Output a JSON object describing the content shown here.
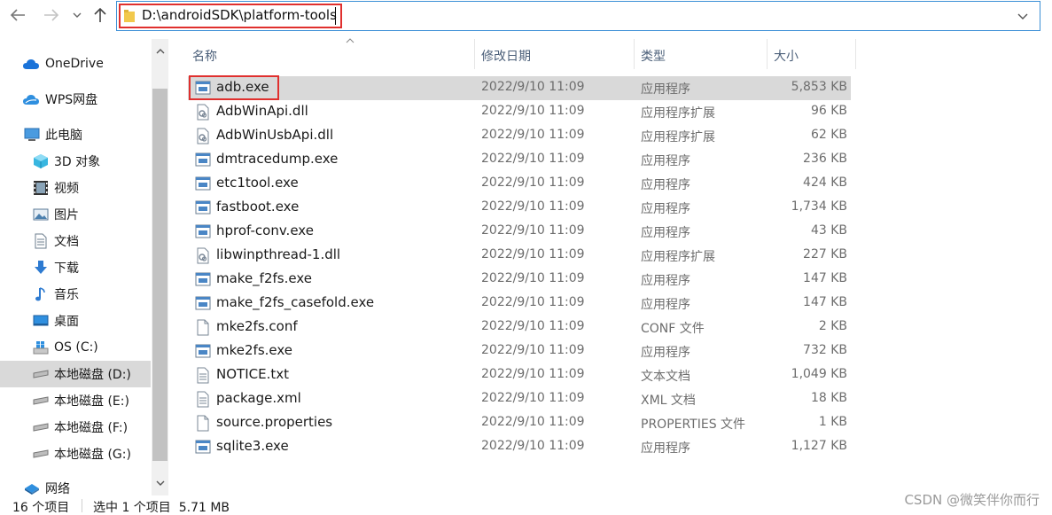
{
  "address_bar": {
    "path": "D:\\androidSDK\\platform-tools"
  },
  "sidebar": {
    "items": [
      {
        "label": "OneDrive",
        "icon": "onedrive-cloud-icon"
      },
      {
        "label": "WPS网盘",
        "icon": "wps-cloud-icon"
      },
      {
        "label": "此电脑",
        "icon": "computer-icon"
      },
      {
        "label": "3D 对象",
        "icon": "3d-objects-icon"
      },
      {
        "label": "视频",
        "icon": "video-icon"
      },
      {
        "label": "图片",
        "icon": "pictures-icon"
      },
      {
        "label": "文档",
        "icon": "documents-icon"
      },
      {
        "label": "下载",
        "icon": "download-icon"
      },
      {
        "label": "音乐",
        "icon": "music-icon"
      },
      {
        "label": "桌面",
        "icon": "desktop-icon"
      },
      {
        "label": "OS (C:)",
        "icon": "windows-drive-icon"
      },
      {
        "label": "本地磁盘 (D:)",
        "icon": "drive-icon",
        "selected": true
      },
      {
        "label": "本地磁盘 (E:)",
        "icon": "drive-icon"
      },
      {
        "label": "本地磁盘 (F:)",
        "icon": "drive-icon"
      },
      {
        "label": "本地磁盘 (G:)",
        "icon": "drive-icon"
      },
      {
        "label": "网络",
        "icon": "network-icon"
      }
    ]
  },
  "columns": {
    "name": "名称",
    "date": "修改日期",
    "type": "类型",
    "size": "大小"
  },
  "files": [
    {
      "name": "adb.exe",
      "date": "2022/9/10 11:09",
      "type": "应用程序",
      "size": "5,853 KB",
      "icon": "exe-icon",
      "selected": true
    },
    {
      "name": "AdbWinApi.dll",
      "date": "2022/9/10 11:09",
      "type": "应用程序扩展",
      "size": "96 KB",
      "icon": "dll-icon"
    },
    {
      "name": "AdbWinUsbApi.dll",
      "date": "2022/9/10 11:09",
      "type": "应用程序扩展",
      "size": "62 KB",
      "icon": "dll-icon"
    },
    {
      "name": "dmtracedump.exe",
      "date": "2022/9/10 11:09",
      "type": "应用程序",
      "size": "236 KB",
      "icon": "exe-icon"
    },
    {
      "name": "etc1tool.exe",
      "date": "2022/9/10 11:09",
      "type": "应用程序",
      "size": "424 KB",
      "icon": "exe-icon"
    },
    {
      "name": "fastboot.exe",
      "date": "2022/9/10 11:09",
      "type": "应用程序",
      "size": "1,734 KB",
      "icon": "exe-icon"
    },
    {
      "name": "hprof-conv.exe",
      "date": "2022/9/10 11:09",
      "type": "应用程序",
      "size": "43 KB",
      "icon": "exe-icon"
    },
    {
      "name": "libwinpthread-1.dll",
      "date": "2022/9/10 11:09",
      "type": "应用程序扩展",
      "size": "227 KB",
      "icon": "dll-icon"
    },
    {
      "name": "make_f2fs.exe",
      "date": "2022/9/10 11:09",
      "type": "应用程序",
      "size": "147 KB",
      "icon": "exe-icon"
    },
    {
      "name": "make_f2fs_casefold.exe",
      "date": "2022/9/10 11:09",
      "type": "应用程序",
      "size": "147 KB",
      "icon": "exe-icon"
    },
    {
      "name": "mke2fs.conf",
      "date": "2022/9/10 11:09",
      "type": "CONF 文件",
      "size": "2 KB",
      "icon": "file-icon"
    },
    {
      "name": "mke2fs.exe",
      "date": "2022/9/10 11:09",
      "type": "应用程序",
      "size": "732 KB",
      "icon": "exe-icon"
    },
    {
      "name": "NOTICE.txt",
      "date": "2022/9/10 11:09",
      "type": "文本文档",
      "size": "1,049 KB",
      "icon": "text-file-icon"
    },
    {
      "name": "package.xml",
      "date": "2022/9/10 11:09",
      "type": "XML 文档",
      "size": "18 KB",
      "icon": "text-file-icon"
    },
    {
      "name": "source.properties",
      "date": "2022/9/10 11:09",
      "type": "PROPERTIES 文件",
      "size": "1 KB",
      "icon": "file-icon"
    },
    {
      "name": "sqlite3.exe",
      "date": "2022/9/10 11:09",
      "type": "应用程序",
      "size": "1,127 KB",
      "icon": "exe-icon"
    }
  ],
  "status": {
    "item_count": "16 个项目",
    "selection": "选中 1 个项目  5.71 MB"
  },
  "watermark": "CSDN @微笑伴你而行",
  "colors": {
    "highlight_box": "#e0302e",
    "selected_row": "#d9d9d9",
    "column_header": "#4c607a"
  }
}
